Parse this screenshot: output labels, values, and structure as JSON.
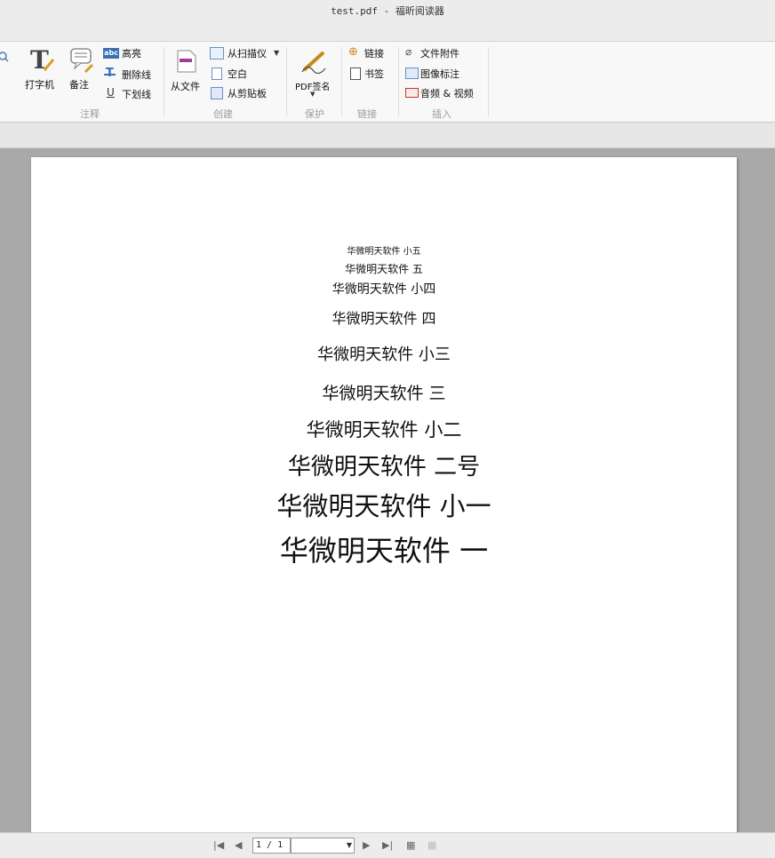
{
  "window": {
    "title": "test.pdf - 福昕阅读器"
  },
  "ribbon": {
    "annotate": {
      "group_name": "注释",
      "typewriter": "打字机",
      "note": "备注",
      "highlight": "高亮",
      "strikeout": "删除线",
      "underline": "下划线",
      "highlight_icon_text": "abc",
      "underline_icon_text": "U"
    },
    "create": {
      "group_name": "创建",
      "from_file": "从文件",
      "from_scanner": "从扫描仪",
      "blank": "空白",
      "from_clipboard": "从剪贴板"
    },
    "protect": {
      "group_name": "保护",
      "pdf_sign": "PDF签名"
    },
    "links": {
      "group_name": "链接",
      "link": "链接",
      "bookmark": "书签"
    },
    "insert": {
      "group_name": "插入",
      "file_attachment": "文件附件",
      "image_annotation": "图像标注",
      "audio_video": "音频 & 视频"
    }
  },
  "document": {
    "lines": [
      {
        "text": "华微明天软件 小五",
        "size": 10
      },
      {
        "text": "华微明天软件 五",
        "size": 12
      },
      {
        "text": "华微明天软件 小四",
        "size": 14
      },
      {
        "text": "华微明天软件 四",
        "size": 16
      },
      {
        "text": "华微明天软件 小三",
        "size": 18
      },
      {
        "text": "华微明天软件 三",
        "size": 19
      },
      {
        "text": "华微明天软件 小二",
        "size": 21
      },
      {
        "text": "华微明天软件 二号",
        "size": 26
      },
      {
        "text": "华微明天软件 小一",
        "size": 29
      },
      {
        "text": "华微明天软件 一",
        "size": 32
      }
    ]
  },
  "statusbar": {
    "page_indicator": "1 / 1"
  },
  "colors": {
    "accent": "#d9a020",
    "sign_icon": "#c68a1a",
    "create_icon": "#9b3f93",
    "audio_icon": "#c0392b"
  }
}
